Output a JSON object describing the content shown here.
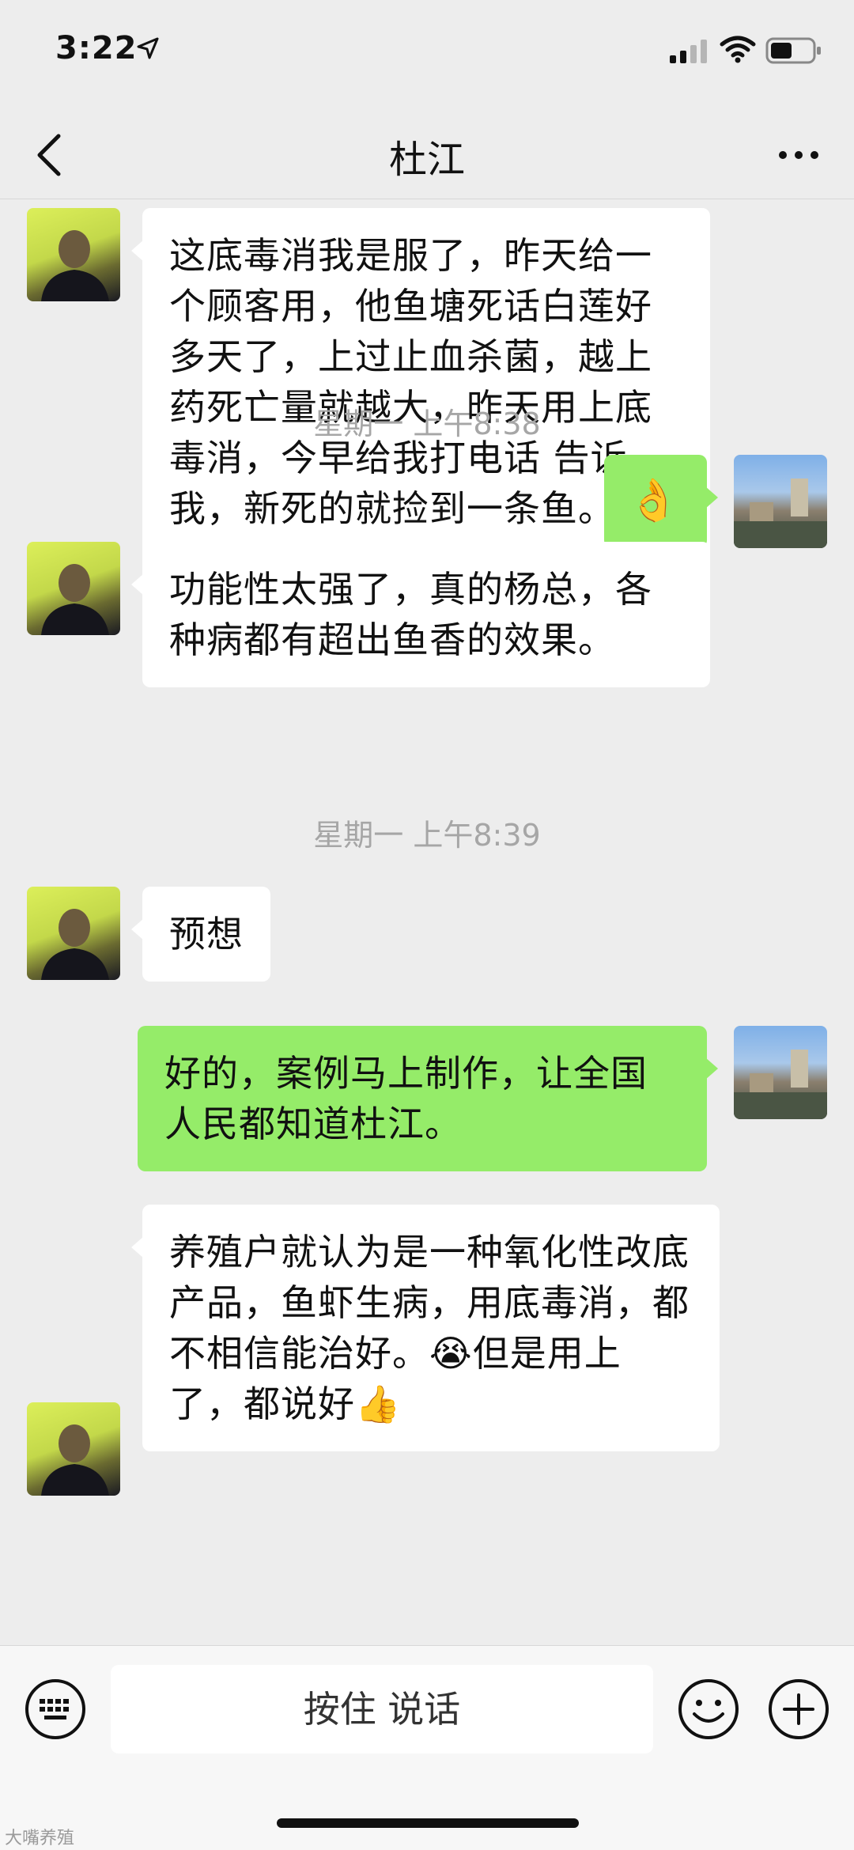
{
  "status_bar": {
    "time": "3:22",
    "icons": [
      "location-arrow-icon",
      "signal-icon",
      "wifi-icon",
      "battery-icon"
    ]
  },
  "nav": {
    "title": "杜江",
    "back_icon": "chevron-left-icon",
    "more_icon": "more-dots-icon"
  },
  "messages": [
    {
      "side": "in",
      "text": "这底毒消我是服了，昨天给一个顾客用，他鱼塘死话白莲好多天了，上过止血杀菌，越上药死亡量就越大，昨天用上底毒消，今早给我打电话 告诉我，新死的就捡到一条鱼。"
    },
    {
      "type": "time",
      "text": "星期一 上午8:38"
    },
    {
      "side": "out",
      "emoji": "👌"
    },
    {
      "side": "in",
      "text": "功能性太强了，真的杨总，各种病都有超出鱼香的效果。"
    },
    {
      "type": "time",
      "text": "星期一 上午8:39"
    },
    {
      "side": "in",
      "text": "预想"
    },
    {
      "side": "out",
      "text": "好的，案例马上制作，让全国人民都知道杜江。"
    },
    {
      "side": "in",
      "text": "养殖户就认为是一种氧化性改底产品，鱼虾生病，用底毒消，都不相信能治好。",
      "emoji_1": "😭",
      "text_2": "但是用上了，都说好",
      "emoji_2": "👍"
    }
  ],
  "input_bar": {
    "voice_label": "按住 说话",
    "left_icon": "keyboard-icon",
    "emoji_icon": "smiley-icon",
    "plus_icon": "plus-circle-icon"
  },
  "watermark": "大嘴养殖"
}
